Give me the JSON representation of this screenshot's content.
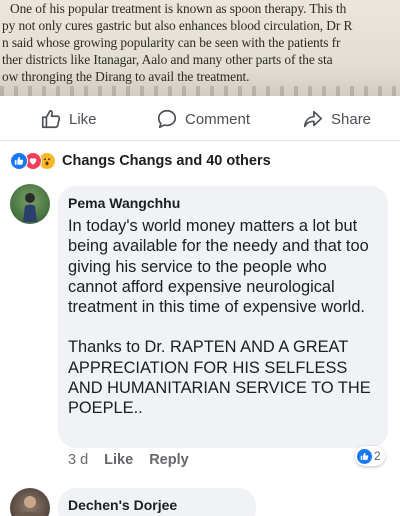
{
  "clipping": {
    "lines": [
      "One of his popular treatment is known as spoon therapy. This th",
      "py not only cures gastric but also enhances blood circulation, Dr R",
      "n said whose growing popularity can be seen with the patients fr",
      "ther districts like Itanagar, Aalo and many other parts of the sta",
      "ow thronging the Dirang to avail the treatment."
    ]
  },
  "actions": {
    "like_label": "Like",
    "comment_label": "Comment",
    "share_label": "Share"
  },
  "reactions": {
    "types": [
      "like",
      "love",
      "wow"
    ],
    "summary": "Changs Changs and 40 others"
  },
  "comments": [
    {
      "author": "Pema Wangchhu",
      "paragraphs": [
        "In today's world money matters a lot but being available for the needy and that too giving his service to the people who cannot afford expensive neurological treatment in this time of expensive world.",
        "Thanks to Dr. RAPTEN AND A GREAT APPRECIATION FOR HIS SELFLESS AND HUMANITARIAN SERVICE TO THE POEPLE.."
      ],
      "time": "3 d",
      "like_label": "Like",
      "reply_label": "Reply",
      "reaction_count": "2"
    },
    {
      "author": "Dechen's Dorjee"
    }
  ],
  "colors": {
    "like_blue": "#1877f2",
    "love_red": "#f33e58",
    "wow_yellow": "#f7b928",
    "bubble_bg": "#f0f2f5",
    "meta_gray": "#65676b"
  }
}
